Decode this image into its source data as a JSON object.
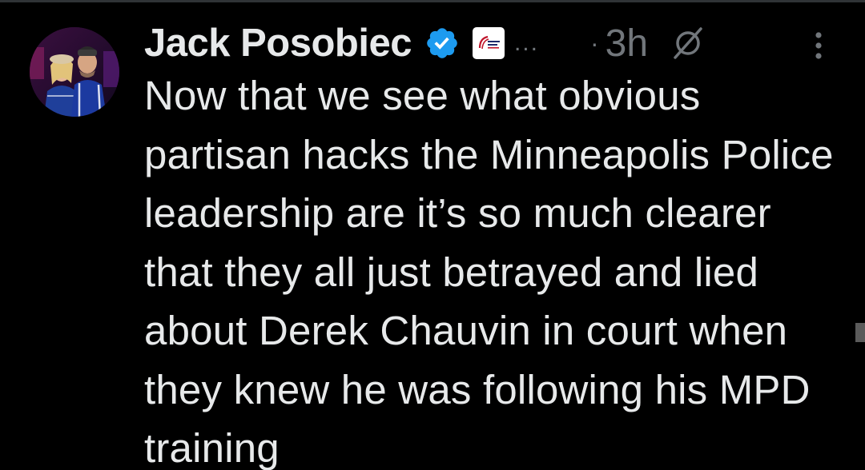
{
  "tweet": {
    "display_name": "Jack Posobiec",
    "verified": true,
    "affiliation_badge": "affiliation-logo",
    "name_overflow": "...",
    "separator": "·",
    "timestamp": "3h",
    "text": "Now that we see what obvious partisan hacks the Minneapolis Police leadership are it’s so much clearer that they all just betrayed and lied about Derek Chauvin in court when they knew he was following his MPD training"
  },
  "icons": {
    "verified": "verified-badge-icon",
    "grok": "grok-icon",
    "more": "more-vertical-icon"
  },
  "colors": {
    "background": "#000000",
    "text_primary": "#e7e9ea",
    "text_secondary": "#71767b",
    "verified_blue": "#1d9bf0"
  }
}
